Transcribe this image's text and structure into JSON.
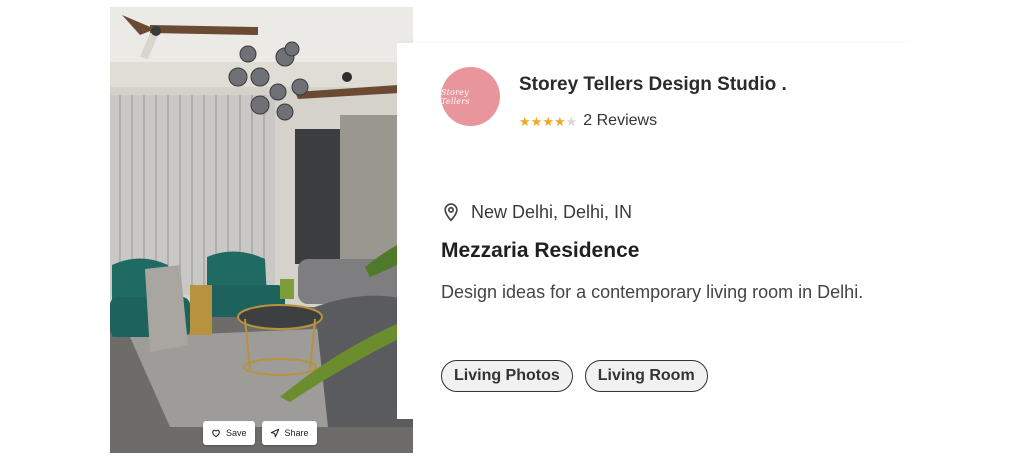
{
  "photo": {
    "save_label": "Save",
    "share_label": "Share",
    "save_icon": "heart-icon",
    "share_icon": "send-icon"
  },
  "studio": {
    "avatar_text": "Storey Tellers",
    "name": "Storey Tellers Design Studio .",
    "rating": 4,
    "rating_max": 5,
    "reviews": "2 Reviews"
  },
  "project": {
    "location_icon": "map-pin-icon",
    "location": "New Delhi, Delhi, IN",
    "title": "Mezzaria Residence",
    "description": "Design ideas for a contemporary living room in Delhi."
  },
  "tags": [
    "Living Photos",
    "Living Room"
  ],
  "colors": {
    "star": "#f5a623",
    "avatar": "#e8959c",
    "tag_bg": "#f1f1f1"
  }
}
